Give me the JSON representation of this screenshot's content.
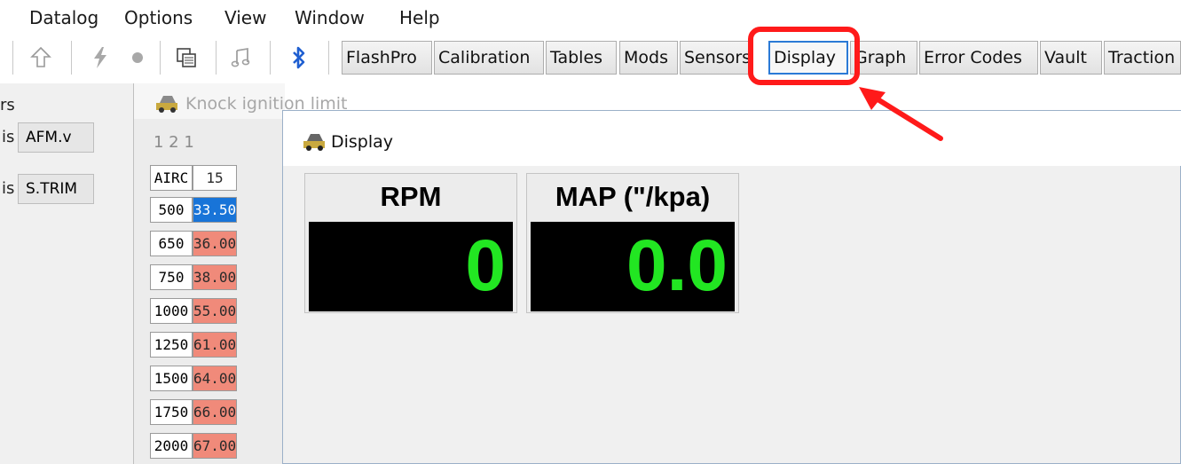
{
  "menu": [
    "Datalog",
    "Options",
    "View",
    "Window",
    "Help"
  ],
  "toolbar": {
    "icons": [
      "arrow-up-icon",
      "lightning-icon",
      "record-dot-icon",
      "copy-windows-icon",
      "music-note-icon",
      "bluetooth-icon"
    ],
    "buttons": [
      "FlashPro",
      "Calibration",
      "Tables",
      "Mods",
      "Sensors",
      "Display",
      "Graph",
      "Error Codes",
      "Vault",
      "Traction"
    ],
    "active_button": "Display",
    "highlight_color": "#ff1a1a"
  },
  "left_panel": {
    "header_fragment": "rs",
    "rows": [
      {
        "prefix": "is",
        "value": "AFM.v"
      },
      {
        "prefix": "is",
        "value": "S.TRIM"
      }
    ]
  },
  "table_window": {
    "title": "Knock ignition limit",
    "toolbar_text": "1  2   1",
    "corner": "AIRC",
    "column": "15",
    "rows": [
      {
        "label": "500",
        "value": "33.50"
      },
      {
        "label": "650",
        "value": "36.00"
      },
      {
        "label": "750",
        "value": "38.00"
      },
      {
        "label": "1000",
        "value": "55.00"
      },
      {
        "label": "1250",
        "value": "61.00"
      },
      {
        "label": "1500",
        "value": "64.00"
      },
      {
        "label": "1750",
        "value": "66.00"
      },
      {
        "label": "2000",
        "value": "67.00"
      }
    ]
  },
  "display_window": {
    "title": "Display",
    "gauges": [
      {
        "label": "RPM",
        "value": "0"
      },
      {
        "label": "MAP (\"/kpa)",
        "value": "0.0"
      }
    ],
    "value_color": "#22e622"
  }
}
